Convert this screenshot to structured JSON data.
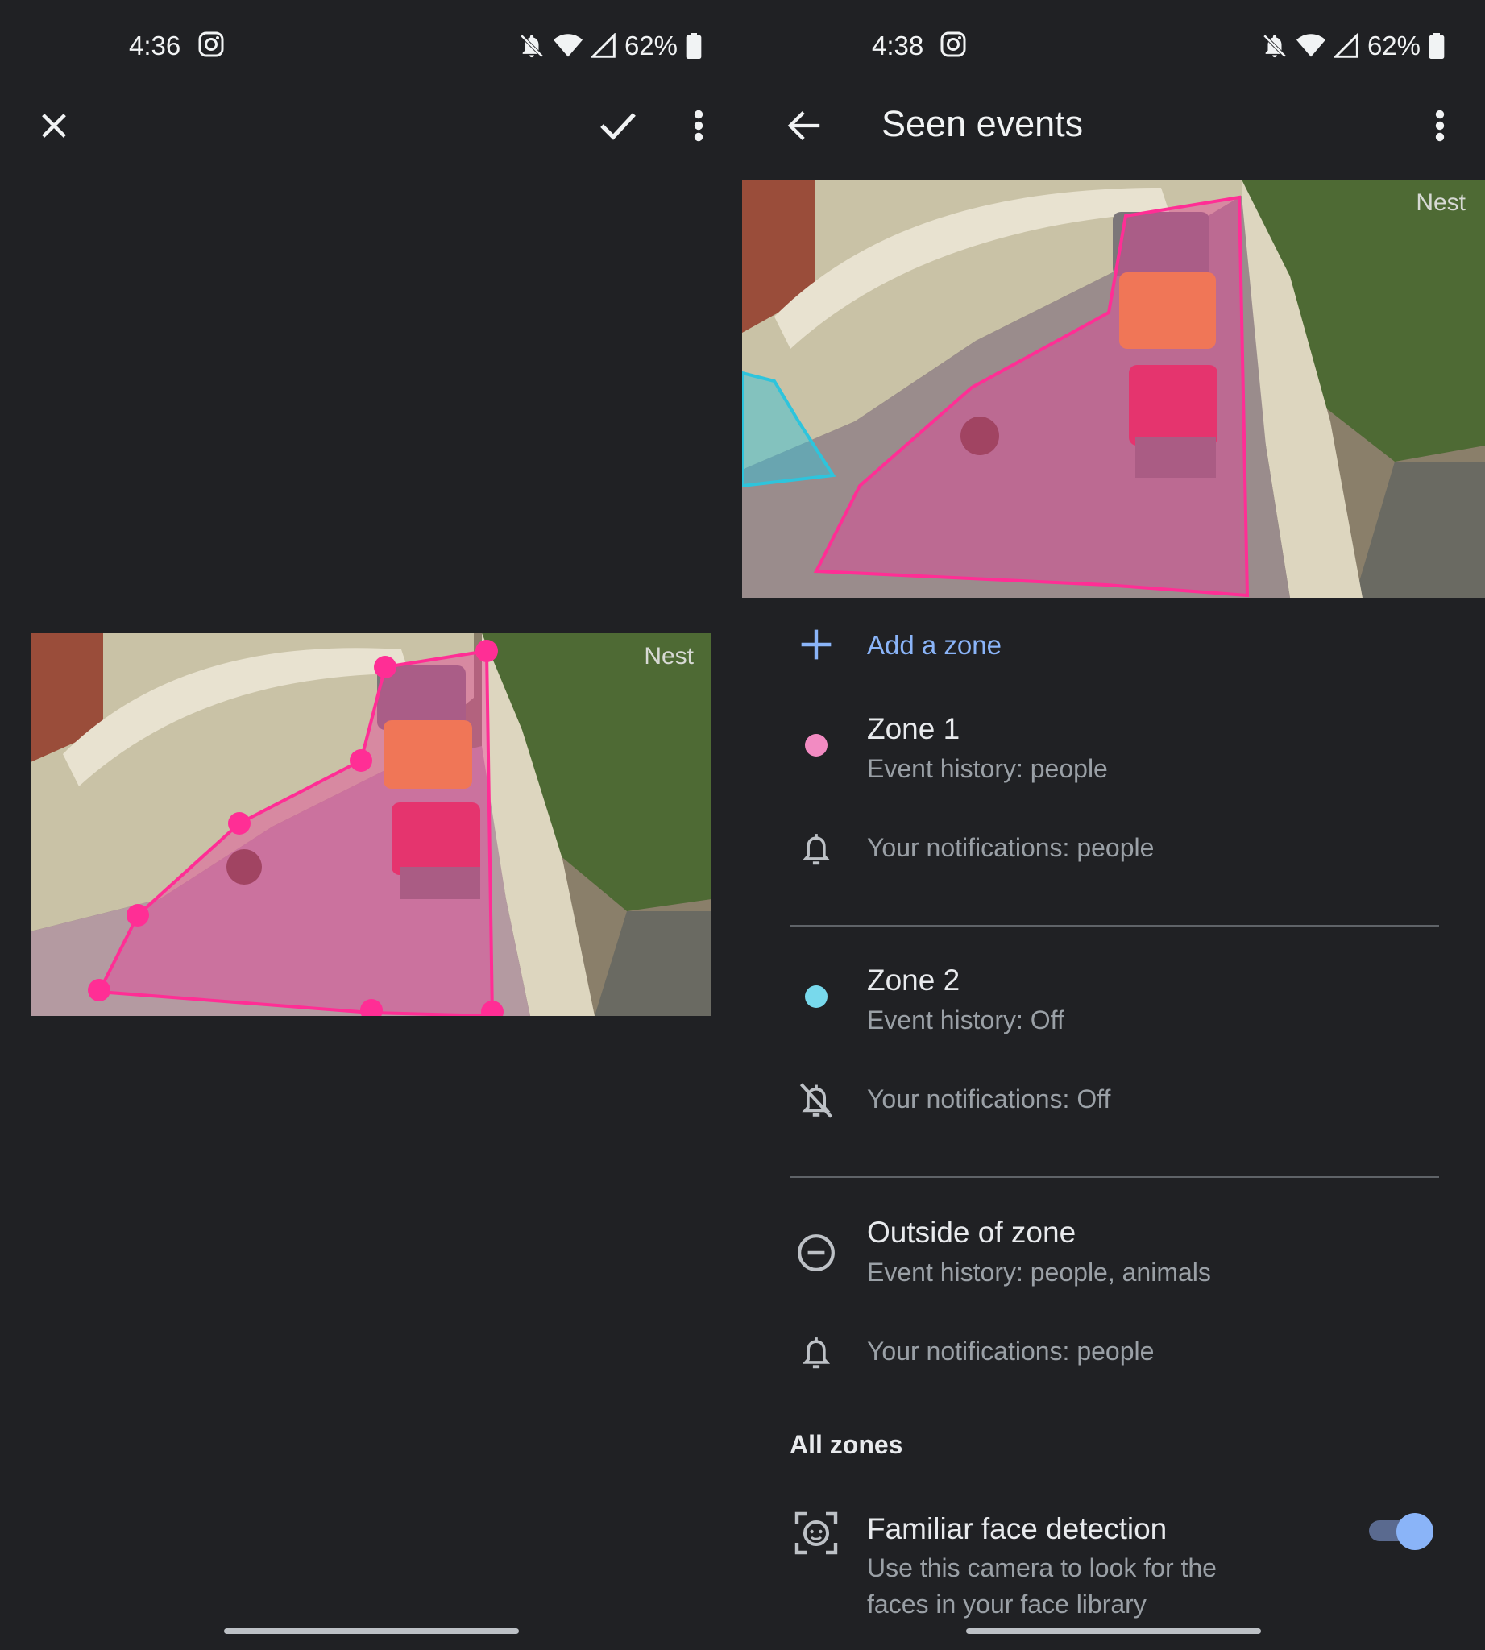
{
  "left_screen": {
    "status_bar": {
      "time": "4:36",
      "battery": "62%"
    },
    "toolbar": {
      "close_icon": "close-icon",
      "confirm_icon": "check-icon",
      "more_icon": "more-vert-icon"
    },
    "camera": {
      "watermark": "Nest"
    }
  },
  "right_screen": {
    "status_bar": {
      "time": "4:38",
      "battery": "62%"
    },
    "app_bar": {
      "title": "Seen events",
      "back_icon": "arrow-back-icon",
      "more_icon": "more-vert-icon"
    },
    "camera": {
      "watermark": "Nest"
    },
    "add_zone": {
      "label": "Add a zone",
      "icon": "plus-icon"
    },
    "zones": [
      {
        "name": "Zone 1",
        "color": "#f28bc2",
        "event_history": "Event history: people",
        "notifications": "Your notifications: people",
        "notification_icon": "bell-icon"
      },
      {
        "name": "Zone 2",
        "color": "#78d9ec",
        "event_history": "Event history: Off",
        "notifications": "Your notifications: Off",
        "notification_icon": "bell-off-icon"
      },
      {
        "name": "Outside of zone",
        "color": "",
        "event_history": "Event history: people, animals",
        "notifications": "Your notifications: people",
        "notification_icon": "bell-icon"
      }
    ],
    "all_zones": {
      "heading": "All zones",
      "familiar_face": {
        "title": "Familiar face detection",
        "description_line1": "Use this camera to look for the",
        "description_line2": "faces in your face library",
        "enabled": true
      }
    }
  },
  "colors": {
    "background": "#202124",
    "accent": "#8ab4f8",
    "zone1_outline": "#f0359a",
    "zone2_outline": "#2ec4dc"
  }
}
